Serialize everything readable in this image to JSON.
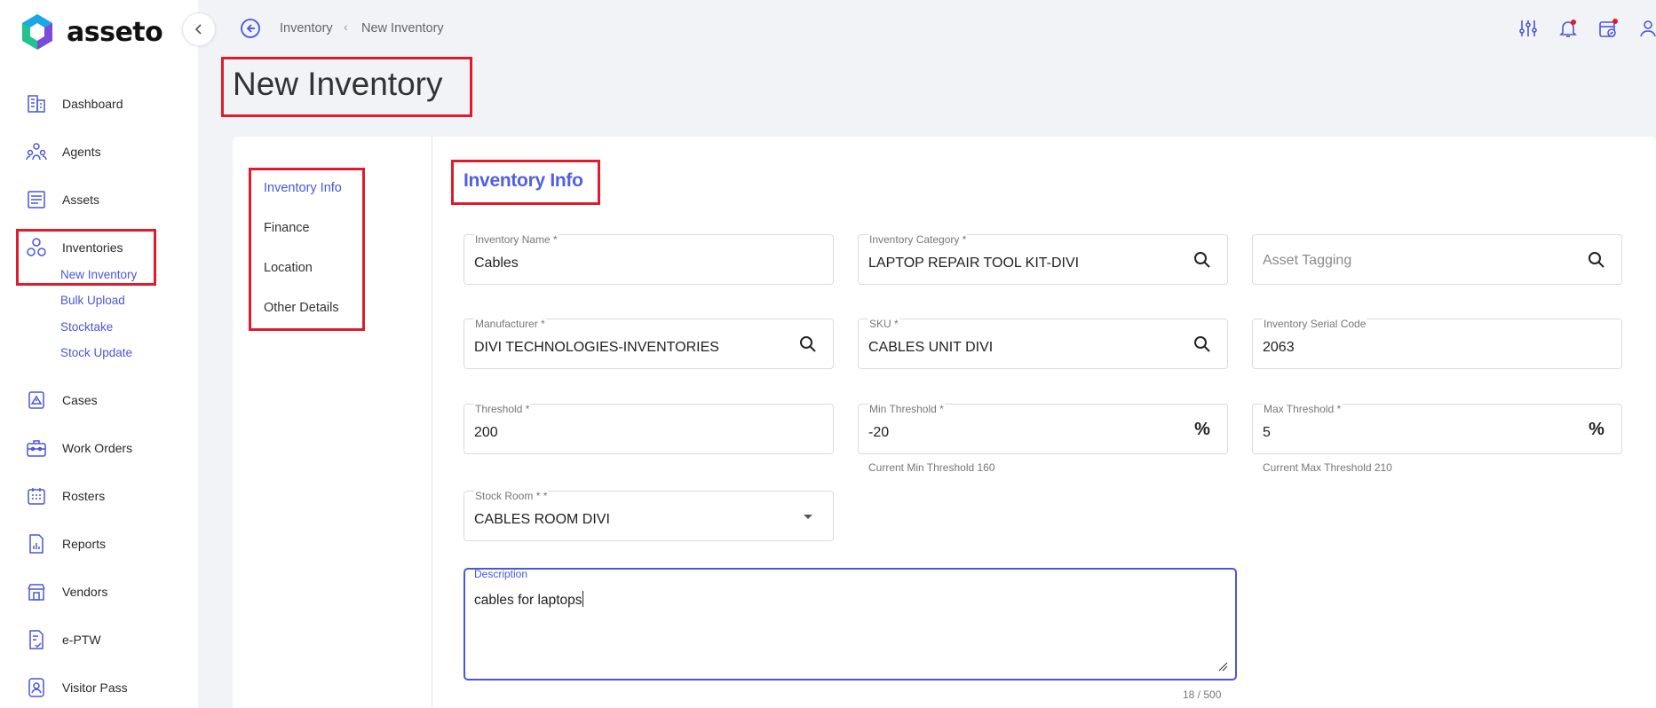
{
  "app": {
    "name": "asseto"
  },
  "breadcrumb": {
    "parent": "Inventory",
    "current": "New Inventory"
  },
  "page": {
    "title": "New Inventory"
  },
  "sidebar": {
    "items": [
      {
        "label": "Dashboard",
        "icon": "dashboard-icon"
      },
      {
        "label": "Agents",
        "icon": "agents-icon"
      },
      {
        "label": "Assets",
        "icon": "assets-icon"
      },
      {
        "label": "Inventories",
        "icon": "inventories-icon"
      },
      {
        "label": "Cases",
        "icon": "cases-icon"
      },
      {
        "label": "Work Orders",
        "icon": "work-orders-icon"
      },
      {
        "label": "Rosters",
        "icon": "rosters-icon"
      },
      {
        "label": "Reports",
        "icon": "reports-icon"
      },
      {
        "label": "Vendors",
        "icon": "vendors-icon"
      },
      {
        "label": "e-PTW",
        "icon": "eptw-icon"
      },
      {
        "label": "Visitor Pass",
        "icon": "visitor-pass-icon"
      }
    ],
    "subitems": [
      "New Inventory",
      "Bulk Upload",
      "Stocktake",
      "Stock Update"
    ]
  },
  "form_nav": [
    "Inventory Info",
    "Finance",
    "Location",
    "Other Details"
  ],
  "section": {
    "title": "Inventory Info"
  },
  "form": {
    "inventory_name": {
      "label": "Inventory Name *",
      "value": "Cables"
    },
    "inventory_category": {
      "label": "Inventory Category *",
      "value": "LAPTOP REPAIR TOOL KIT-DIVI"
    },
    "asset_tagging": {
      "placeholder": "Asset Tagging"
    },
    "manufacturer": {
      "label": "Manufacturer *",
      "value": "DIVI TECHNOLOGIES-INVENTORIES"
    },
    "sku": {
      "label": "SKU *",
      "value": "CABLES UNIT DIVI"
    },
    "serial_code": {
      "label": "Inventory Serial Code",
      "value": "2063"
    },
    "threshold": {
      "label": "Threshold *",
      "value": "200"
    },
    "min_threshold": {
      "label": "Min Threshold *",
      "value": "-20",
      "hint": "Current Min Threshold  160"
    },
    "max_threshold": {
      "label": "Max Threshold *",
      "value": "5",
      "hint": "Current Max Threshold  210"
    },
    "stock_room": {
      "label": "Stock Room * *",
      "value": "CABLES ROOM DIVI"
    },
    "description": {
      "label": "Description",
      "value": "cables for laptops",
      "counter": "18 / 500"
    }
  },
  "colors": {
    "accent": "#4a56d8",
    "highlight": "#e01b2b"
  }
}
